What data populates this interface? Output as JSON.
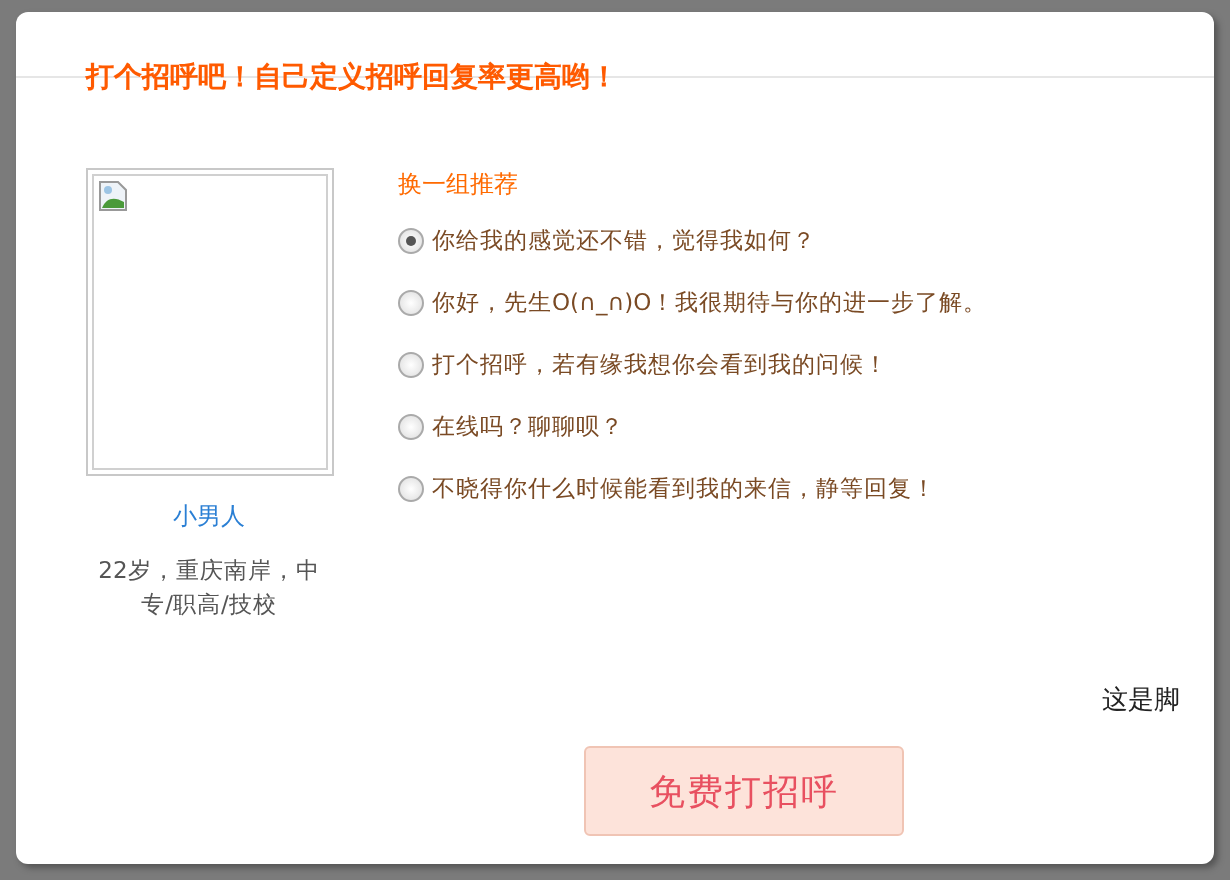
{
  "dialog": {
    "title": "打个招呼吧！自己定义招呼回复率更高哟！"
  },
  "profile": {
    "name": "小男人",
    "details": "22岁，重庆南岸，中专/职高/技校"
  },
  "greetings": {
    "refresh_link": "换一组推荐",
    "options": [
      {
        "text": "你给我的感觉还不错，觉得我如何？",
        "selected": true
      },
      {
        "text": "你好，先生O(∩_∩)O！我很期待与你的进一步了解。",
        "selected": false
      },
      {
        "text": "打个招呼，若有缘我想你会看到我的问候！",
        "selected": false
      },
      {
        "text": "在线吗？聊聊呗？",
        "selected": false
      },
      {
        "text": "不晓得你什么时候能看到我的来信，静等回复！",
        "selected": false
      }
    ]
  },
  "footer": {
    "text": "这是脚"
  },
  "send_button": {
    "label": "免费打招呼"
  }
}
